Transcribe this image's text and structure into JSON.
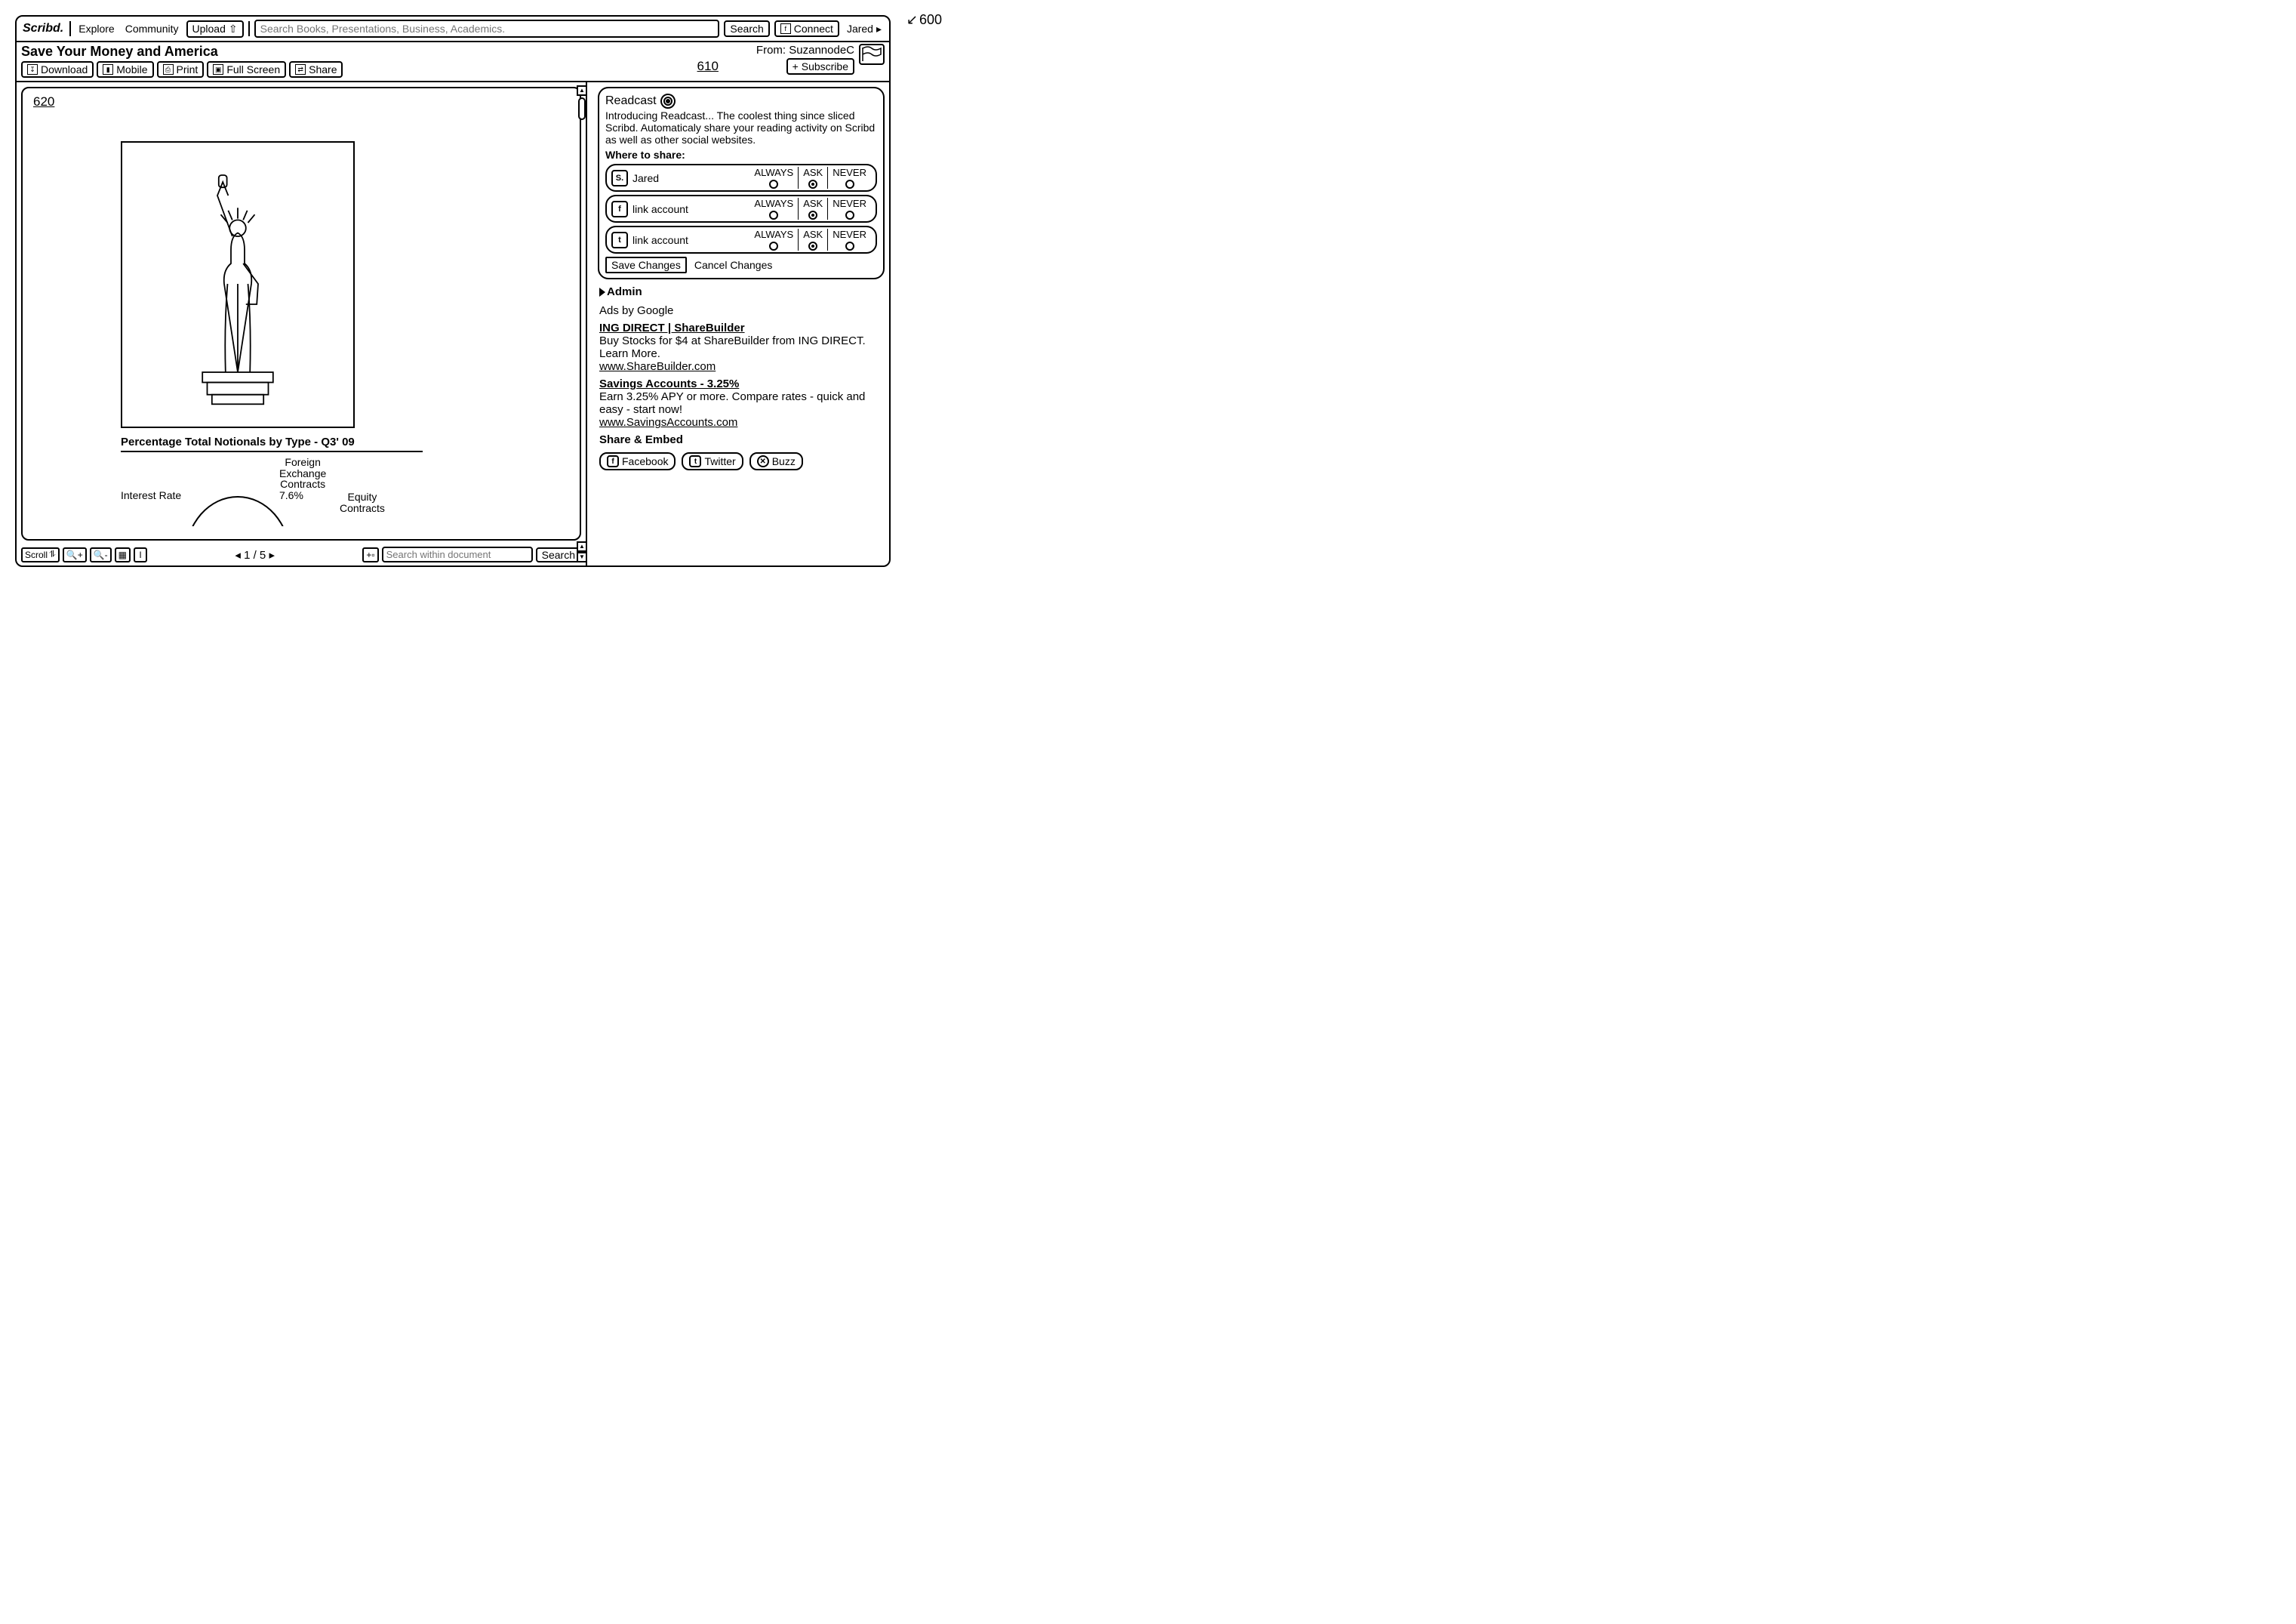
{
  "refs": {
    "r600": "600",
    "r610": "610",
    "r620": "620"
  },
  "topbar": {
    "logo": "Scribd.",
    "explore": "Explore",
    "community": "Community",
    "upload": "Upload",
    "search_placeholder": "Search Books, Presentations, Business, Academics.",
    "search_btn": "Search",
    "connect": "Connect",
    "user": "Jared"
  },
  "doc": {
    "title": "Save Your Money and America",
    "from_label": "From:",
    "from_user": "SuzannodeC",
    "actions": {
      "download": "Download",
      "mobile": "Mobile",
      "print": "Print",
      "fullscreen": "Full Screen",
      "share": "Share",
      "subscribe": "+ Subscribe"
    }
  },
  "viewer": {
    "chart_title": "Percentage Total Notionals by Type - Q3' 09",
    "labels": {
      "interest": "Interest Rate",
      "fx1": "Foreign",
      "fx2": "Exchange",
      "fx3": "Contracts",
      "fx_pct": "7.6%",
      "equity1": "Equity",
      "equity2": "Contracts"
    },
    "footer": {
      "scroll": "Scroll",
      "page": "1 / 5",
      "search_placeholder": "Search within document",
      "search_btn": "Search"
    }
  },
  "readcast": {
    "title": "Readcast",
    "intro": "Introducing Readcast... The coolest thing since sliced Scribd. Automaticaly share your reading activity on Scribd as well as other social websites.",
    "where": "Where to share:",
    "options": {
      "always": "ALWAYS",
      "ask": "ASK",
      "never": "NEVER"
    },
    "rows": [
      {
        "icon": "S",
        "label": "Jared",
        "selected": "ask"
      },
      {
        "icon": "f",
        "label": "link account",
        "selected": "ask"
      },
      {
        "icon": "t",
        "label": "link account",
        "selected": "ask"
      }
    ],
    "save": "Save Changes",
    "cancel": "Cancel Changes"
  },
  "side": {
    "admin": "Admin",
    "ads_by": "Ads by Google",
    "ad1": {
      "title": "ING DIRECT  |  ShareBuilder",
      "body": "Buy Stocks for $4 at ShareBuilder from ING DIRECT. Learn More.",
      "url": "www.ShareBuilder.com"
    },
    "ad2": {
      "title": "Savings Accounts - 3.25%",
      "body": "Earn 3.25% APY or more. Compare rates - quick and easy - start now!",
      "url": "www.SavingsAccounts.com"
    },
    "share_embed": "Share & Embed",
    "social": {
      "fb": "Facebook",
      "tw": "Twitter",
      "bz": "Buzz"
    }
  },
  "chart_data": {
    "type": "pie",
    "title": "Percentage Total Notionals by Type - Q3' 09",
    "series": [
      {
        "name": "Interest Rate",
        "value": null
      },
      {
        "name": "Foreign Exchange Contracts",
        "value": 7.6
      },
      {
        "name": "Equity Contracts",
        "value": null
      }
    ],
    "note": "Only the 7.6% label for Foreign Exchange Contracts is visible; other slice values are cut off in the screenshot."
  }
}
